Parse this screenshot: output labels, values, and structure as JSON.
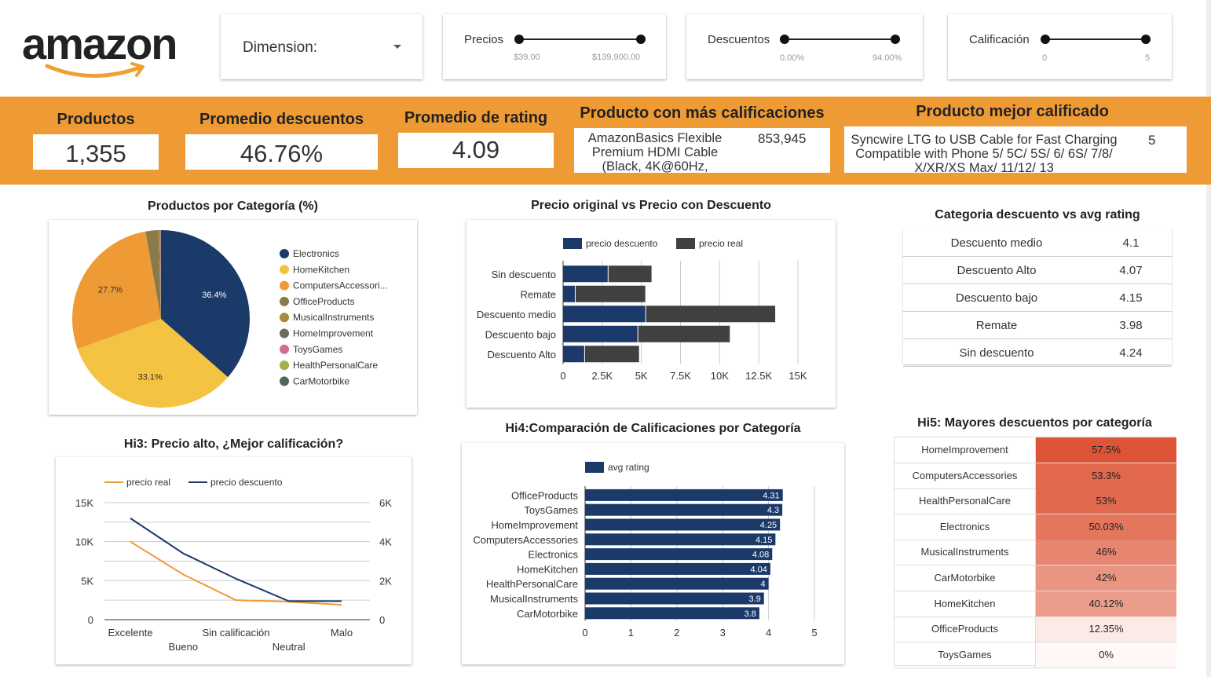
{
  "logo": {
    "text": "amazon"
  },
  "filters": {
    "dimension": {
      "label": "Dimension:"
    },
    "precios": {
      "label": "Precios",
      "min": "$39.00",
      "max": "$139,900.00"
    },
    "descuentos": {
      "label": "Descuentos",
      "min": "0.00%",
      "max": "94.00%"
    },
    "calificacion": {
      "label": "Calificación",
      "min": "0",
      "max": "5"
    }
  },
  "kpis": {
    "productos": {
      "title": "Productos",
      "value": "1,355"
    },
    "promedio_descuentos": {
      "title": "Promedio descuentos",
      "value": "46.76%"
    },
    "promedio_rating": {
      "title": "Promedio de rating",
      "value": "4.09"
    },
    "mas_calificaciones": {
      "title": "Producto con más calificaciones",
      "name": "AmazonBasics Flexible Premium HDMI Cable (Black, 4K@60Hz,",
      "value": "853,945"
    },
    "mejor_calificado": {
      "title": "Producto mejor calificado",
      "name": "Syncwire LTG to USB Cable for Fast Charging Compatible with Phone 5/ 5C/ 5S/ 6/ 6S/ 7/8/ X/XR/XS Max/ 11/12/ 13",
      "value": "5"
    }
  },
  "colors": {
    "navy": "#1b3a69",
    "gray": "#404040",
    "orange": "#ef9b35",
    "yellow": "#f5c342"
  },
  "chart_data": [
    {
      "type": "pie",
      "title": "Productos por Categoría (%)",
      "categories": [
        "Electronics",
        "HomeKitchen",
        "ComputersAccessori...",
        "OfficeProducts",
        "MusicalInstruments",
        "HomeImprovement",
        "ToysGames",
        "HealthPersonalCare",
        "CarMotorbike"
      ],
      "values": [
        36.4,
        33.1,
        27.7,
        2.3,
        0.2,
        0.1,
        0.1,
        0.05,
        0.05
      ],
      "labels": [
        "36.4%",
        "33.1%",
        "27.7%",
        "",
        "",
        "",
        "",
        "",
        ""
      ],
      "colors": [
        "#1b3a69",
        "#f5c342",
        "#ef9b35",
        "#8a7a4a",
        "#a78a3a",
        "#6b6b5a",
        "#d66b93",
        "#a3b04a",
        "#4a6b5a"
      ],
      "legend": "right"
    },
    {
      "type": "bar",
      "orientation": "horizontal",
      "stacked": true,
      "title": "Precio original vs Precio con Descuento",
      "categories": [
        "Sin descuento",
        "Remate",
        "Descuento medio",
        "Descuento bajo",
        "Descuento Alto"
      ],
      "series": [
        {
          "name": "precio descuento",
          "values": [
            2900,
            800,
            5300,
            4800,
            1400
          ],
          "color": "#1b3a69"
        },
        {
          "name": "precio real",
          "values": [
            2800,
            4500,
            8300,
            5900,
            3500
          ],
          "color": "#404040"
        }
      ],
      "xticks": [
        "0",
        "2.5K",
        "5K",
        "7.5K",
        "10K",
        "12.5K",
        "15K"
      ],
      "xlim": [
        0,
        15000
      ],
      "legend": "top"
    },
    {
      "type": "table",
      "title": "Categoria descuento vs avg rating",
      "rows": [
        [
          "Descuento medio",
          "4.1"
        ],
        [
          "Descuento Alto",
          "4.07"
        ],
        [
          "Descuento bajo",
          "4.15"
        ],
        [
          "Remate",
          "3.98"
        ],
        [
          "Sin descuento",
          "4.24"
        ]
      ]
    },
    {
      "type": "line",
      "title": "Hi3: Precio alto, ¿Mejor calificación?",
      "categories": [
        "Excelente",
        "Bueno",
        "Sin calificación",
        "Neutral",
        "Malo"
      ],
      "series": [
        {
          "name": "precio real",
          "axis": "left",
          "values": [
            10000,
            5800,
            2500,
            2300,
            1900
          ],
          "color": "#ef9b35"
        },
        {
          "name": "precio descuento",
          "axis": "right",
          "values": [
            5200,
            3400,
            2100,
            950,
            950
          ],
          "color": "#1b3a69"
        }
      ],
      "yticks_left": [
        "15K",
        "10K",
        "5K",
        "0"
      ],
      "yticks_right": [
        "6K",
        "4K",
        "2K",
        "0"
      ],
      "ylim_left": [
        0,
        15000
      ],
      "ylim_right": [
        0,
        6000
      ],
      "legend": "top"
    },
    {
      "type": "bar",
      "orientation": "horizontal",
      "title": "Hi4:Comparación de Calificaciones por Categoría",
      "categories": [
        "OfficeProducts",
        "ToysGames",
        "HomeImprovement",
        "ComputersAccessories",
        "Electronics",
        "HomeKitchen",
        "HealthPersonalCare",
        "MusicalInstruments",
        "CarMotorbike"
      ],
      "series": [
        {
          "name": "avg rating",
          "values": [
            4.31,
            4.3,
            4.25,
            4.15,
            4.08,
            4.04,
            4,
            3.9,
            3.8
          ],
          "labels": [
            "4.31",
            "4.3",
            "4.25",
            "4.15",
            "4.08",
            "4.04",
            "4",
            "3.9",
            "3.8"
          ],
          "color": "#1b3a69"
        }
      ],
      "xticks": [
        "0",
        "1",
        "2",
        "3",
        "4",
        "5"
      ],
      "xlim": [
        0,
        5
      ],
      "legend": "top"
    },
    {
      "type": "heatmap",
      "title": "Hi5: Mayores descuentos por categoría",
      "categories": [
        "HomeImprovement",
        "ComputersAccessories",
        "HealthPersonalCare",
        "Electronics",
        "MusicalInstruments",
        "CarMotorbike",
        "HomeKitchen",
        "OfficeProducts",
        "ToysGames"
      ],
      "values": [
        57.5,
        53.3,
        53,
        50.03,
        46,
        42,
        40.12,
        12.35,
        0
      ],
      "labels": [
        "57.5%",
        "53.3%",
        "53%",
        "50.03%",
        "46%",
        "42%",
        "40.12%",
        "12.35%",
        "0%"
      ]
    }
  ]
}
